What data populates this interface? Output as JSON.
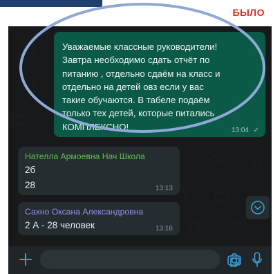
{
  "header": {
    "tag": "БЫЛО"
  },
  "messages": [
    {
      "type": "outgoing",
      "text": "Уважаемые классные руководители!\nЗавтра необходимо сдать отчёт по\nпитанию , отдельно сдаём на класс и\nотдельно на детей овз если у вас\nтакие обучаются. В табеле подаём\nтолько тех детей, которые питались\nКОМПЛЕКСНО!",
      "time": "13:04"
    },
    {
      "type": "incoming",
      "sender": "Нателла Армоевна Нач Школа",
      "lines": [
        "2б",
        "28"
      ],
      "time": "13:13"
    },
    {
      "type": "incoming",
      "sender": "Сахно Оксана Александровна",
      "text": "2 А - 28 человек",
      "time": "13:16"
    }
  ],
  "colors": {
    "outgoing_bubble": "#0b5a48",
    "incoming_bubble": "#262d31",
    "chat_background": "#17191b",
    "highlight_oval": "#8ea9d6",
    "tag": "#e3261c",
    "accent": "#3aa0d8"
  },
  "icons": {
    "attach": "plus-icon",
    "sticker": "sticker-icon",
    "camera": "camera-icon",
    "mic": "microphone-icon",
    "scroll": "chevron-down-icon"
  }
}
